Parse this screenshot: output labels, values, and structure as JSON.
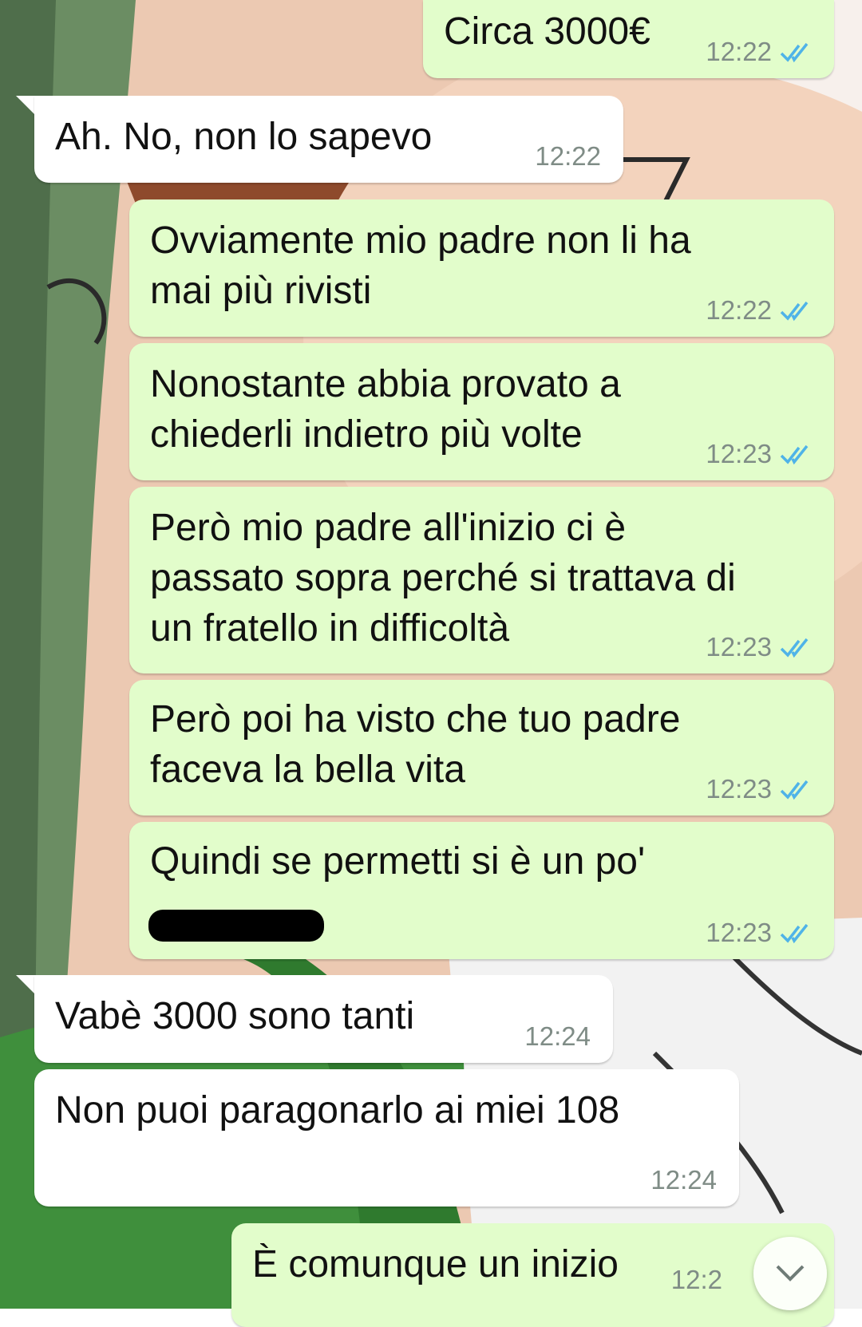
{
  "messages": [
    {
      "dir": "out",
      "text": "Circa 3000€",
      "time": "12:22",
      "status": "read"
    },
    {
      "dir": "in",
      "text": "Ah. No, non lo sapevo",
      "time": "12:22"
    },
    {
      "dir": "out",
      "text": "Ovviamente mio padre non li ha\nmai più rivisti",
      "time": "12:22",
      "status": "read"
    },
    {
      "dir": "out",
      "text": "Nonostante abbia provato a\nchiederli indietro più volte",
      "time": "12:23",
      "status": "read"
    },
    {
      "dir": "out",
      "text": "Però mio padre all'inizio ci è\npassato sopra perché si trattava di\nun fratello in difficoltà",
      "time": "12:23",
      "status": "read"
    },
    {
      "dir": "out",
      "text": "Però poi ha visto che tuo padre\nfaceva la bella vita",
      "time": "12:23",
      "status": "read"
    },
    {
      "dir": "out",
      "text": "Quindi se permetti si è un po'",
      "time": "12:23",
      "status": "read",
      "redacted_line": true
    },
    {
      "dir": "in",
      "text": "Vabè 3000 sono tanti",
      "time": "12:24"
    },
    {
      "dir": "in",
      "text": "Non puoi paragonarlo ai miei 108",
      "time": "12:24"
    },
    {
      "dir": "out",
      "text": "È comunque un inizio",
      "time": "12:2",
      "status": "read"
    }
  ],
  "icons": {
    "read_ticks": "double-check-icon",
    "scroll_down": "chevron-down-icon"
  },
  "colors": {
    "outgoing_bubble": "#e2fdcb",
    "incoming_bubble": "#ffffff",
    "read_tick": "#4fb3e8",
    "timestamp": "#7f8c86"
  }
}
